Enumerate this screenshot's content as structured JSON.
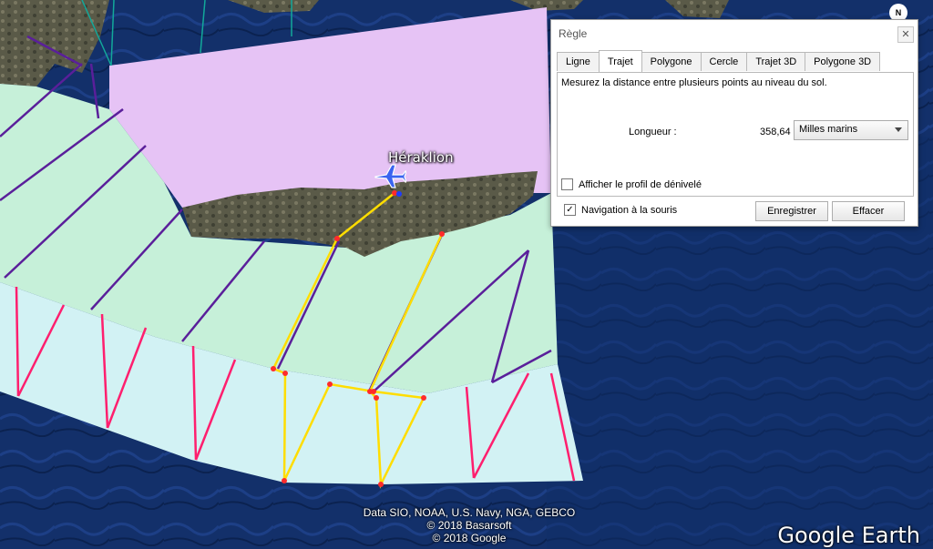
{
  "map": {
    "city_label": "Héraklion",
    "north_label": "N",
    "attribution": [
      "Data SIO, NOAA, U.S. Navy, NGA, GEBCO",
      "© 2018 Basarsoft",
      "© 2018 Google"
    ],
    "brand": "Google Earth",
    "colors": {
      "sea": "#0f2a5e",
      "zone_purple": "#e6c3f5",
      "zone_green": "#c6f0d9",
      "zone_cyan": "#d2f2f4",
      "route": "#ffff33",
      "waypoint": "#ff2b2b",
      "hatch_purple": "#5a1f9a",
      "hatch_pink": "#ff1f6e"
    }
  },
  "dialog": {
    "title": "Règle",
    "close_icon": "close-icon",
    "tabs": [
      {
        "label": "Ligne"
      },
      {
        "label": "Trajet",
        "active": true
      },
      {
        "label": "Polygone"
      },
      {
        "label": "Cercle"
      },
      {
        "label": "Trajet 3D"
      },
      {
        "label": "Polygone 3D"
      }
    ],
    "description": "Mesurez la distance entre plusieurs points au niveau du sol.",
    "length_label": "Longueur :",
    "length_value": "358,64",
    "unit_selected": "Milles marins",
    "profile_checkbox": {
      "label": "Afficher le profil de dénivelé",
      "checked": false
    },
    "mouse_nav_checkbox": {
      "label": "Navigation à la souris",
      "checked": true
    },
    "save_label": "Enregistrer",
    "clear_label": "Effacer"
  }
}
